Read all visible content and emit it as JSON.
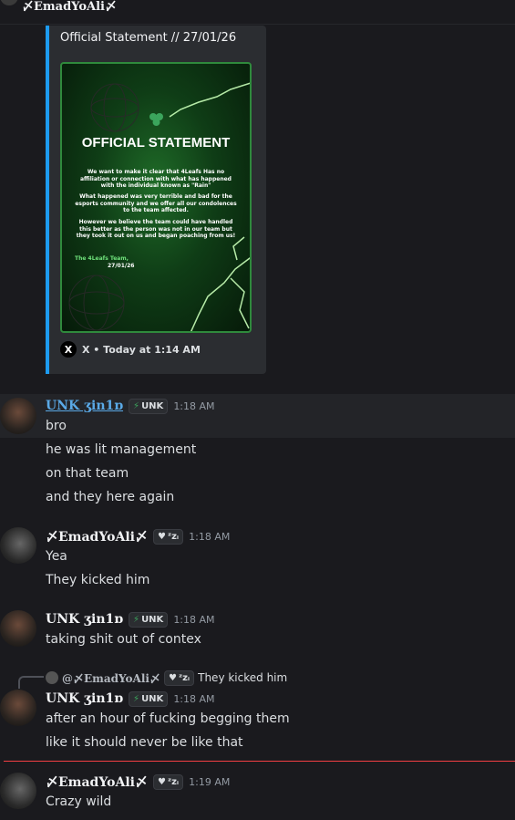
{
  "top_author": "〆EmadYoAli〆",
  "embed": {
    "title": "Official Statement // 27/01/26",
    "image_heading": "OFFICIAL STATEMENT",
    "image_para1": "We want to make it clear that 4Leafs Has no affiliation or connection with what has happened with the individual known as \"Rain\"",
    "image_para2": "What happened was very terrible and bad for the esports community and we offer all our condolences to the team affected.",
    "image_para3": "However we believe the team could have handled this better as the person was not in our team but they took it out on us and began poaching from us!",
    "image_sign": "The 4Leafs Team,",
    "image_date": "27/01/26",
    "footer": "X • Today at 1:14 AM",
    "footer_icon": "x-logo-icon"
  },
  "colors": {
    "embed_accent": "#1d9bf0",
    "unk_name": "#5aa9e6",
    "divider_new": "#f23f43",
    "bolt": "#3ba55c"
  },
  "groups": [
    {
      "author": "UNK ʒin1ɒ",
      "tag": "UNK",
      "time": "1:18 AM",
      "lines": [
        "bro",
        "he was lit management",
        "on that team",
        "and they here again"
      ]
    },
    {
      "author": "〆EmadYoAli〆",
      "tag": "ᶻzᵢ",
      "time": "1:18 AM",
      "lines": [
        "Yea",
        "They kicked him"
      ]
    },
    {
      "author": "UNK ʒin1ɒ",
      "tag": "UNK",
      "time": "1:18 AM",
      "lines": [
        "taking shit out of contex"
      ]
    },
    {
      "reply": {
        "author": "@〆EmadYoAli〆",
        "tag": "ᶻzᵢ",
        "text": "They kicked him"
      },
      "author": "UNK ʒin1ɒ",
      "tag": "UNK",
      "time": "1:18 AM",
      "lines": [
        "after an hour of fucking begging them",
        "like it should never be like that"
      ]
    },
    {
      "author": "〆EmadYoAli〆",
      "tag": "ᶻzᵢ",
      "time": "1:19 AM",
      "lines": [
        "Crazy wild"
      ]
    }
  ]
}
